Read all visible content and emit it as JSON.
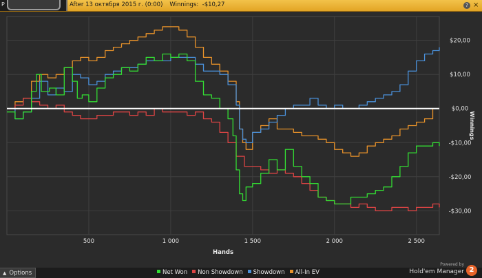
{
  "window": {
    "tab_letter": "P",
    "title": "After 13 октября 2015 г. (0:00)",
    "winnings_label": "Winnings:",
    "winnings_value": "-$10,27",
    "help_label": "?",
    "close_label": "×"
  },
  "footer": {
    "options_label": "Options",
    "powered_by": "Powered by",
    "brand": "Hold'em Manager",
    "brand_badge": "2"
  },
  "colors": {
    "net_won": "#33dd33",
    "non_showdown": "#dd4444",
    "showdown": "#4a90d9",
    "all_in_ev": "#e8922a",
    "zero_line": "#ffffff",
    "grid": "#3f3f3f",
    "plot_bg": "#2b2b2b"
  },
  "chart_data": {
    "type": "line",
    "xlabel": "Hands",
    "ylabel": "Winnings",
    "xlim": [
      0,
      2640
    ],
    "ylim": [
      -37,
      27
    ],
    "x_ticks": [
      500,
      1000,
      1500,
      2000,
      2500
    ],
    "x_tick_labels": [
      "500",
      "1 000",
      "1 500",
      "2 000",
      "2 500"
    ],
    "y_ticks": [
      20,
      10,
      0,
      -10,
      -20,
      -30
    ],
    "y_tick_labels": [
      "$20,00",
      "$10,00",
      "$0,00",
      "-$10,00",
      "-$20,00",
      "-$30,00"
    ],
    "grid": true,
    "legend_position": "bottom",
    "series": [
      {
        "name": "Net Won",
        "x": [
          0,
          50,
          100,
          150,
          180,
          210,
          260,
          300,
          350,
          400,
          430,
          460,
          500,
          550,
          600,
          650,
          700,
          750,
          800,
          850,
          900,
          950,
          1000,
          1050,
          1100,
          1150,
          1200,
          1250,
          1300,
          1350,
          1380,
          1400,
          1420,
          1440,
          1460,
          1500,
          1550,
          1600,
          1650,
          1700,
          1750,
          1800,
          1850,
          1900,
          1950,
          2000,
          2050,
          2100,
          2150,
          2200,
          2250,
          2300,
          2350,
          2400,
          2450,
          2500,
          2550,
          2600,
          2640
        ],
        "y": [
          -1,
          -3,
          -1,
          5,
          10,
          5,
          6,
          4,
          12,
          8,
          3,
          4,
          2,
          6,
          9,
          10,
          12,
          11,
          13,
          15,
          14,
          16,
          15,
          16,
          14,
          8,
          4,
          3,
          0,
          -3,
          -8,
          -18,
          -25,
          -27,
          -23,
          -22,
          -19,
          -15,
          -18,
          -12,
          -17,
          -20,
          -22,
          -26,
          -27,
          -28,
          -28,
          -26,
          -26,
          -25,
          -24,
          -23,
          -20,
          -17,
          -13,
          -11,
          -11,
          -10,
          -11
        ]
      },
      {
        "name": "Non Showdown",
        "x": [
          0,
          50,
          100,
          150,
          200,
          250,
          300,
          350,
          400,
          450,
          500,
          550,
          600,
          650,
          700,
          750,
          800,
          850,
          900,
          950,
          1000,
          1050,
          1100,
          1150,
          1200,
          1250,
          1300,
          1350,
          1400,
          1450,
          1500,
          1550,
          1600,
          1650,
          1700,
          1750,
          1800,
          1850,
          1900,
          1950,
          2000,
          2050,
          2100,
          2150,
          2200,
          2250,
          2300,
          2350,
          2400,
          2450,
          2500,
          2550,
          2600,
          2640
        ],
        "y": [
          0,
          1,
          3,
          2,
          1,
          0,
          1,
          -1,
          -2,
          -3,
          -3,
          -2,
          -2,
          -1,
          -1,
          -2,
          -1,
          -2,
          0,
          -1,
          -1,
          -1,
          -2,
          -1,
          -3,
          -4,
          -7,
          -10,
          -14,
          -17,
          -17,
          -18,
          -19,
          -18,
          -19,
          -20,
          -22,
          -24,
          -26,
          -27,
          -28,
          -28,
          -29,
          -28,
          -29,
          -30,
          -30,
          -29,
          -29,
          -30,
          -29,
          -29,
          -28,
          -29
        ]
      },
      {
        "name": "Showdown",
        "x": [
          0,
          50,
          100,
          150,
          200,
          250,
          300,
          350,
          400,
          450,
          500,
          550,
          600,
          650,
          700,
          750,
          800,
          850,
          900,
          950,
          1000,
          1050,
          1100,
          1150,
          1200,
          1250,
          1300,
          1350,
          1400,
          1420,
          1440,
          1460,
          1500,
          1550,
          1600,
          1650,
          1700,
          1750,
          1800,
          1850,
          1900,
          1950,
          2000,
          2050,
          2100,
          2150,
          2200,
          2250,
          2300,
          2350,
          2400,
          2450,
          2500,
          2550,
          2600,
          2640
        ],
        "y": [
          0,
          -3,
          -1,
          3,
          8,
          4,
          6,
          5,
          10,
          9,
          7,
          8,
          10,
          11,
          12,
          12,
          13,
          14,
          14,
          14,
          15,
          15,
          15,
          13,
          11,
          11,
          10,
          7,
          1,
          -6,
          -9,
          -10,
          -7,
          -6,
          -4,
          -2,
          0,
          1,
          1,
          3,
          1,
          0,
          1,
          0,
          0,
          1,
          2,
          3,
          4,
          5,
          7,
          11,
          14,
          16,
          17,
          18
        ]
      },
      {
        "name": "All-In EV",
        "x": [
          0,
          50,
          100,
          150,
          200,
          250,
          300,
          350,
          400,
          450,
          500,
          550,
          600,
          650,
          700,
          750,
          800,
          850,
          900,
          950,
          1000,
          1050,
          1100,
          1150,
          1200,
          1250,
          1300,
          1350,
          1400,
          1420,
          1440,
          1460,
          1500,
          1550,
          1600,
          1650,
          1700,
          1750,
          1800,
          1850,
          1900,
          1950,
          2000,
          2050,
          2100,
          2150,
          2200,
          2250,
          2300,
          2350,
          2400,
          2450,
          2500,
          2550,
          2600,
          2640
        ],
        "y": [
          0,
          2,
          3,
          8,
          10,
          9,
          10,
          12,
          14,
          15,
          14,
          15,
          17,
          18,
          19,
          20,
          21,
          22,
          23,
          24,
          24,
          23,
          21,
          18,
          15,
          13,
          11,
          8,
          2,
          -6,
          -10,
          -12,
          -7,
          -5,
          -3,
          -6,
          -6,
          -7,
          -8,
          -8,
          -9,
          -10,
          -12,
          -13,
          -14,
          -13,
          -11,
          -10,
          -9,
          -8,
          -6,
          -5,
          -4,
          -3,
          0,
          0
        ]
      }
    ]
  }
}
